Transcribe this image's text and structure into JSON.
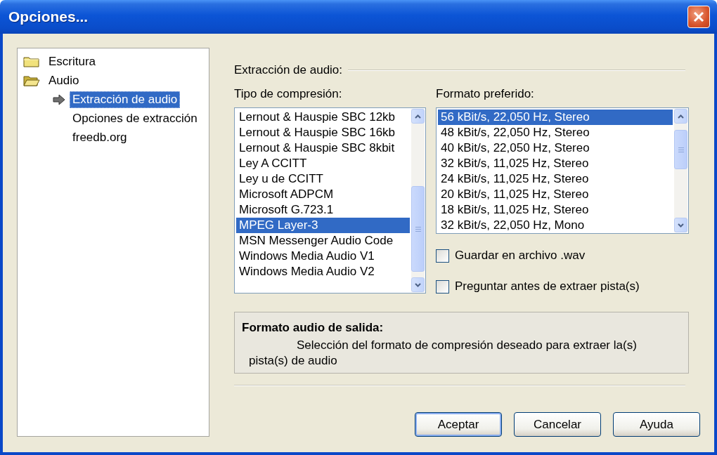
{
  "window": {
    "title": "Opciones..."
  },
  "tree": [
    {
      "label": "Escritura",
      "kind": "folder",
      "expanded": false
    },
    {
      "label": "Audio",
      "kind": "folder",
      "expanded": true,
      "children": [
        {
          "label": "Extracción de audio",
          "selected": true
        },
        {
          "label": "Opciones de extracción",
          "selected": false
        },
        {
          "label": "freedb.org",
          "selected": false
        }
      ]
    }
  ],
  "section_title": "Extracción de audio:",
  "compression": {
    "label": "Tipo de compresión:",
    "items": [
      {
        "label": "Lernout & Hauspie SBC 12kb",
        "selected": false
      },
      {
        "label": "Lernout & Hauspie SBC 16kb",
        "selected": false
      },
      {
        "label": "Lernout & Hauspie SBC 8kbit",
        "selected": false
      },
      {
        "label": "Ley A CCITT",
        "selected": false
      },
      {
        "label": "Ley u de CCITT",
        "selected": false
      },
      {
        "label": "Microsoft ADPCM",
        "selected": false
      },
      {
        "label": "Microsoft G.723.1",
        "selected": false
      },
      {
        "label": "MPEG Layer-3",
        "selected": true
      },
      {
        "label": "MSN Messenger Audio Code",
        "selected": false
      },
      {
        "label": "Windows Media Audio V1",
        "selected": false
      },
      {
        "label": "Windows Media Audio V2",
        "selected": false
      }
    ]
  },
  "format": {
    "label": "Formato preferido:",
    "items": [
      {
        "label": "56 kBit/s, 22,050 Hz, Stereo",
        "selected": true
      },
      {
        "label": "48 kBit/s, 22,050 Hz, Stereo",
        "selected": false
      },
      {
        "label": "40 kBit/s, 22,050 Hz, Stereo",
        "selected": false
      },
      {
        "label": "32 kBit/s, 11,025 Hz, Stereo",
        "selected": false
      },
      {
        "label": "24 kBit/s, 11,025 Hz, Stereo",
        "selected": false
      },
      {
        "label": "20 kBit/s, 11,025 Hz, Stereo",
        "selected": false
      },
      {
        "label": "18 kBit/s, 11,025 Hz, Stereo",
        "selected": false
      },
      {
        "label": "32 kBit/s, 22,050 Hz, Mono",
        "selected": false
      }
    ]
  },
  "checkboxes": [
    {
      "label": "Guardar en archivo .wav",
      "checked": false
    },
    {
      "label": "Preguntar antes de extraer pista(s)",
      "checked": false
    }
  ],
  "info": {
    "title": "Formato audio de salida:",
    "description": "Selección del formato de compresión deseado para extraer la(s) pista(s) de audio"
  },
  "buttons": [
    {
      "label": "Aceptar",
      "default": true
    },
    {
      "label": "Cancelar",
      "default": false
    },
    {
      "label": "Ayuda",
      "default": false
    }
  ]
}
